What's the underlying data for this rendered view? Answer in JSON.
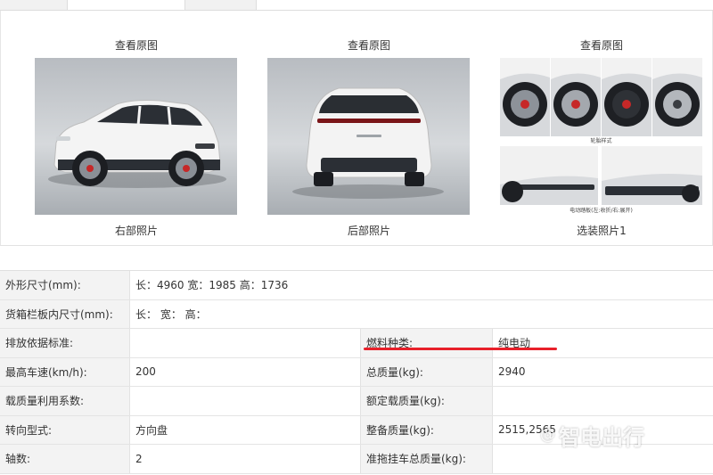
{
  "photos": [
    {
      "view_label": "查看原图",
      "caption": "右部照片"
    },
    {
      "view_label": "查看原图",
      "caption": "后部照片"
    },
    {
      "view_label": "查看原图",
      "caption": "选装照片1"
    }
  ],
  "option_sheet": {
    "wheel_label": "轮胎样式",
    "step_label": "电动踏板(左:收折/右:展开)"
  },
  "specs": {
    "dimensions_label": "外形尺寸(mm):",
    "dimensions_value": "长：4960 宽：1985 高：1736",
    "cargo_label": "货箱栏板内尺寸(mm):",
    "cargo_value": "长：  宽：  高：",
    "emission_label": "排放依据标准:",
    "emission_value": "",
    "fuel_label": "燃料种类:",
    "fuel_value": "纯电动",
    "maxspeed_label": "最高车速(km/h):",
    "maxspeed_value": "200",
    "gross_label": "总质量(kg):",
    "gross_value": "2940",
    "loadutil_label": "载质量利用系数:",
    "loadutil_value": "",
    "ratedload_label": "额定载质量(kg):",
    "ratedload_value": "",
    "steering_label": "转向型式:",
    "steering_value": "方向盘",
    "curb_label": "整备质量(kg):",
    "curb_value": "2515,2565",
    "axles_label": "轴数:",
    "axles_value": "2",
    "trailer_label": "准拖挂车总质量(kg):",
    "trailer_value": ""
  },
  "watermark": {
    "text": "智电出行",
    "symbol": "@"
  },
  "colors": {
    "accent_underline": "#e8202a",
    "label_bg": "#f3f3f3"
  }
}
